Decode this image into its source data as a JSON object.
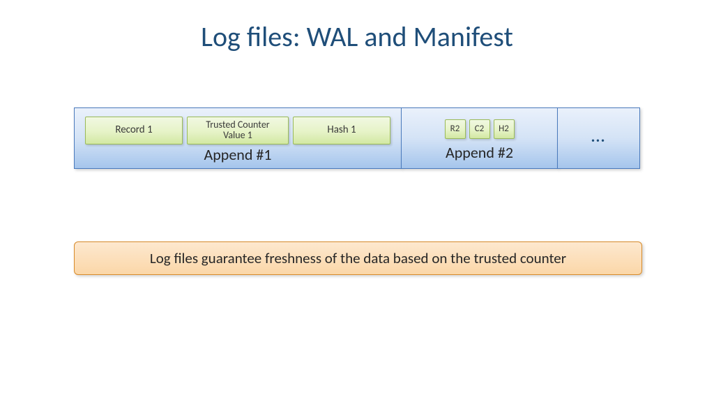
{
  "title": "Log files: WAL and Manifest",
  "strip": {
    "append1": {
      "label": "Append #1",
      "items": [
        "Record 1",
        "Trusted Counter\nValue 1",
        "Hash 1"
      ]
    },
    "append2": {
      "label": "Append #2",
      "items": [
        "R2",
        "C2",
        "H2"
      ]
    },
    "ellipsis": "…"
  },
  "callout": "Log files guarantee freshness of the data based on the trusted counter"
}
